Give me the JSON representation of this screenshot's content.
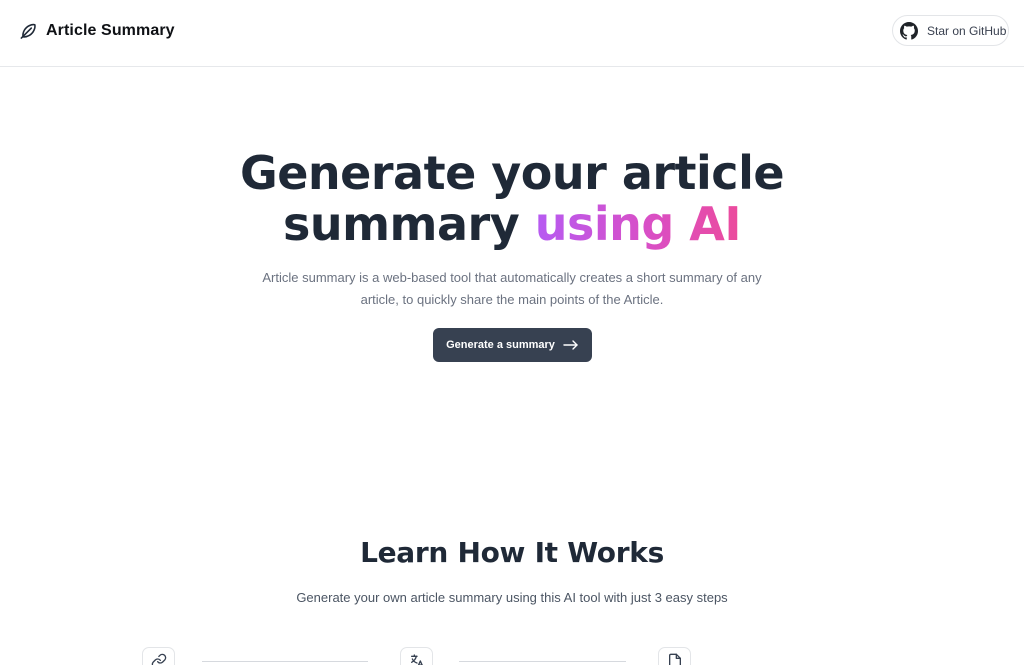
{
  "header": {
    "brand_name": "Article Summary",
    "brand_icon": "feather-icon",
    "github_label": "Star on GitHub",
    "github_icon": "github-icon"
  },
  "hero": {
    "title_line1": "Generate your article",
    "title_line2_plain": "summary ",
    "title_line2_gradient": "using AI",
    "subtitle": "Article summary is a web-based tool that automatically creates a short summary of any article, to quickly share the main points of the Article.",
    "cta_label": "Generate a summary",
    "cta_icon": "arrow-right-icon"
  },
  "how_it_works": {
    "title": "Learn How It Works",
    "subtitle": "Generate your own article summary using this AI tool with just 3 easy steps",
    "steps": [
      {
        "icon": "link-icon"
      },
      {
        "icon": "translate-icon"
      },
      {
        "icon": "document-icon"
      }
    ]
  },
  "colors": {
    "text_dark": "#1f2937",
    "button_bg": "#374151",
    "gradient_start": "#b65bf2",
    "gradient_end": "#ec4b9c",
    "muted_text": "#6b7280"
  }
}
